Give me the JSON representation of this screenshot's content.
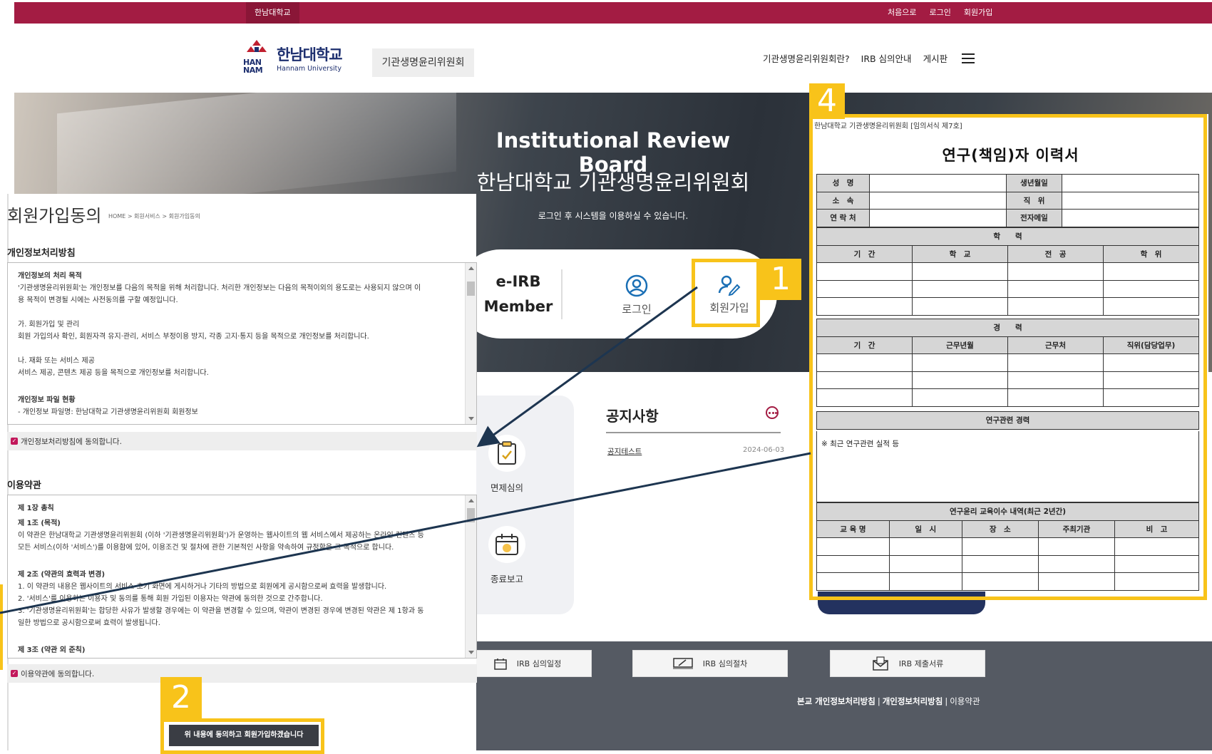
{
  "topbar": {
    "home": "한남대학교",
    "links": [
      "처음으로",
      "로그인",
      "회원가입"
    ]
  },
  "header": {
    "logo_mark_text": "HAN NAM",
    "logo_ko": "한남대학교",
    "logo_en": "Hannam University",
    "committee": "기관생명윤리위원회",
    "nav": [
      "기관생명윤리위원회란?",
      "IRB 심의안내",
      "게시판"
    ]
  },
  "hero": {
    "title": "Institutional Review Board",
    "subtitle": "한남대학교 기관생명윤리위원회",
    "note": "로그인 후 시스템을 이용하실 수 있습니다."
  },
  "member": {
    "label_line1": "e-IRB",
    "label_line2": "Member",
    "login": "로그인",
    "signup": "회원가입"
  },
  "callouts": [
    "1",
    "2",
    "4"
  ],
  "side_menu": [
    "면제심의",
    "종료보고"
  ],
  "notice": {
    "title": "공지사항",
    "item": "공지테스트",
    "date": "2024-06-03"
  },
  "footer": {
    "buttons": [
      "IRB 심의일정",
      "IRB 심의절차",
      "IRB 제출서류"
    ],
    "links": [
      "본교 개인정보처리방침",
      "개인정보처리방침",
      "이용약관"
    ]
  },
  "signup": {
    "title": "회원가입동의",
    "breadcrumb": "HOME > 회원서비스 > 회원가입동의",
    "privacy_title": "개인정보처리방침",
    "privacy_lines": [
      {
        "t": "개인정보의 처리 목적",
        "b": true
      },
      {
        "t": "'기관생명윤리위원회'는 개인정보를 다음의 목적을 위해 처리합니다. 처리한 개인정보는 다음의 목적이외의 용도로는 사용되지 않으며 이",
        "b": false
      },
      {
        "t": "용 목적이 변경될 시에는 사전동의를 구할 예정입니다.",
        "b": false
      },
      {
        "t": "",
        "b": false
      },
      {
        "t": "가. 회원가입 및 관리",
        "b": false
      },
      {
        "t": "회원 가입의사 확인, 회원자격 유지·관리, 서비스 부정이용 방지, 각종 고지·통지 등을 목적으로 개인정보를 처리합니다.",
        "b": false
      },
      {
        "t": "",
        "b": false
      },
      {
        "t": "나. 재화 또는 서비스 제공",
        "b": false
      },
      {
        "t": "서비스 제공, 콘텐츠 제공 등을 목적으로 개인정보를 처리합니다.",
        "b": false
      },
      {
        "t": "",
        "b": false
      },
      {
        "t": "개인정보 파일 현황",
        "b": true
      },
      {
        "t": "- 개인정보 파일명: 한남대학교 기관생명윤리위원회 회원정보",
        "b": false
      }
    ],
    "privacy_agree": "개인정보처리방침에 동의합니다.",
    "terms_title": "이용약관",
    "terms_lines": [
      {
        "t": "제 1장 총칙",
        "b": true
      },
      {
        "t": "제 1조 (목적)",
        "b": true
      },
      {
        "t": "이 약관은 한남대학교 기관생명윤리위원회 (이하 '기관생명윤리위원회')가 운영하는 웹사이트의 웹 서비스에서 제공하는 온라인 컨텐츠 등",
        "b": false
      },
      {
        "t": "모든 서비스(이하 '서비스')를 이용함에 있어, 이용조건 및 절차에 관한 기본적인 사항을 약속하여 규정함을 그 목적으로 합니다.",
        "b": false
      },
      {
        "t": "",
        "b": false
      },
      {
        "t": "제 2조 (약관의 효력과 변경)",
        "b": true
      },
      {
        "t": "1. 이 약관의 내용은 웹사이트의 서비스 초기 화면에 게시하거나 기타의 방법으로 회원에게 공시함으로써 효력을 발생합니다.",
        "b": false
      },
      {
        "t": "2. '서비스'를 이용하는 이용자 및 동의를 통해 회원 가입된 이용자는 약관에 동의한 것으로 간주합니다.",
        "b": false
      },
      {
        "t": "3. '기관생명윤리위원회'는 합당한 사유가 발생할 경우에는 이 약관을 변경할 수 있으며, 약관이 변경된 경우에 변경된 약관은 제 1항과 동",
        "b": false
      },
      {
        "t": "    일한 방법으로 공시함으로써 효력이 발생됩니다.",
        "b": false
      },
      {
        "t": "",
        "b": false
      },
      {
        "t": "제 3조 (약관 외 준칙)",
        "b": true
      }
    ],
    "terms_agree": "이용약관에 동의합니다.",
    "submit": "위 내용에 동의하고 회원가입하겠습니다"
  },
  "resume": {
    "header": "한남대학교 기관생명윤리위원회 [임의서식 제7호]",
    "title": "연구(책임)자 이력서",
    "labels": {
      "name": "성　명",
      "birth": "생년월일",
      "affiliation": "소　속",
      "position": "직　위",
      "contact": "연 락 처",
      "email": "전자메일"
    },
    "education": {
      "title": "학　　력",
      "cols": [
        "기　간",
        "학　교",
        "전　공",
        "학　위"
      ]
    },
    "career": {
      "title": "경　　력",
      "cols": [
        "기　간",
        "근무년월",
        "근무처",
        "직위(담당업무)"
      ]
    },
    "research": {
      "title": "연구관련 경력",
      "note": "※ 최근 연구관련 실적 등"
    },
    "training": {
      "title": "연구윤리 교육이수 내역(최근 2년간)",
      "cols": [
        "교 육 명",
        "일　시",
        "장　소",
        "주최기관",
        "비　고"
      ]
    }
  },
  "colors": {
    "brand": "#a31c43",
    "callout": "#f8c31a",
    "arrow": "#1d3550",
    "footer": "#555a63"
  }
}
